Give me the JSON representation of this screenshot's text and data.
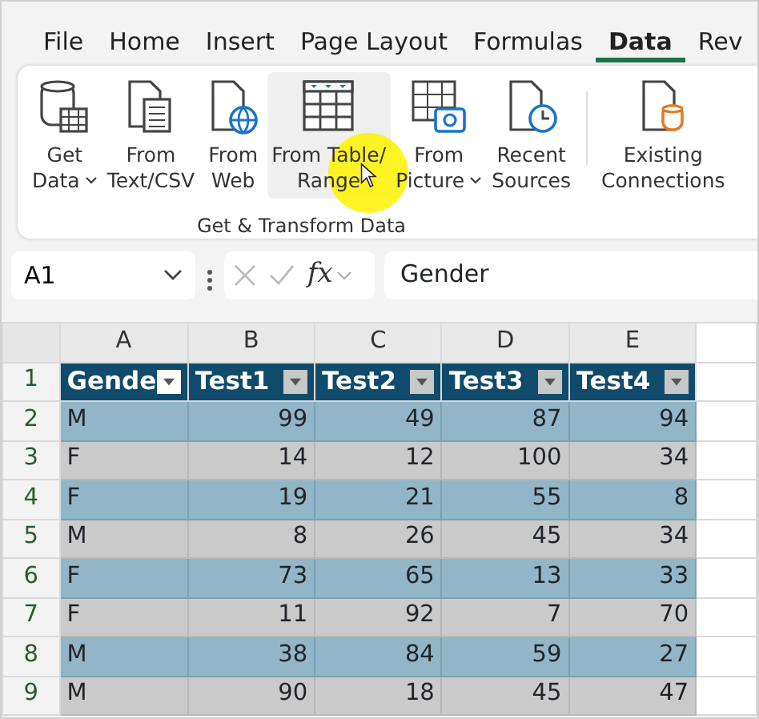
{
  "menu_tabs": [
    {
      "label": "File",
      "selected": false
    },
    {
      "label": "Home",
      "selected": false
    },
    {
      "label": "Insert",
      "selected": false
    },
    {
      "label": "Page Layout",
      "selected": false
    },
    {
      "label": "Formulas",
      "selected": false
    },
    {
      "label": "Data",
      "selected": true
    },
    {
      "label": "Rev",
      "selected": false
    }
  ],
  "ribbon": {
    "buttons": [
      {
        "lines": [
          "Get",
          "Data"
        ],
        "dropdown": true,
        "hovered": false
      },
      {
        "lines": [
          "From",
          "Text/CSV"
        ],
        "dropdown": false,
        "hovered": false
      },
      {
        "lines": [
          "From",
          "Web"
        ],
        "dropdown": false,
        "hovered": false
      },
      {
        "lines": [
          "From Table/",
          "Range"
        ],
        "dropdown": false,
        "hovered": true
      },
      {
        "lines": [
          "From",
          "Picture"
        ],
        "dropdown": true,
        "hovered": false
      },
      {
        "lines": [
          "Recent",
          "Sources"
        ],
        "dropdown": false,
        "hovered": false
      }
    ],
    "group_label": "Get & Transform Data",
    "extra_buttons": [
      {
        "lines": [
          "Existing",
          "Connections"
        ],
        "dropdown": false,
        "hovered": false
      }
    ]
  },
  "formula_bar": {
    "name_box": "A1",
    "function_label": "fx",
    "formula": "Gender"
  },
  "sheet": {
    "columns": [
      "A",
      "B",
      "C",
      "D",
      "E"
    ],
    "header_row": {
      "number": "1",
      "cells": [
        {
          "label": "Gende",
          "selected": true
        },
        {
          "label": "Test1",
          "selected": false
        },
        {
          "label": "Test2",
          "selected": false
        },
        {
          "label": "Test3",
          "selected": false
        },
        {
          "label": "Test4",
          "selected": false
        }
      ]
    },
    "rows": [
      {
        "number": "2",
        "cells": [
          "M",
          "99",
          "49",
          "87",
          "94"
        ]
      },
      {
        "number": "3",
        "cells": [
          "F",
          "14",
          "12",
          "100",
          "34"
        ]
      },
      {
        "number": "4",
        "cells": [
          "F",
          "19",
          "21",
          "55",
          "8"
        ]
      },
      {
        "number": "5",
        "cells": [
          "M",
          "8",
          "26",
          "45",
          "34"
        ]
      },
      {
        "number": "6",
        "cells": [
          "F",
          "73",
          "65",
          "13",
          "33"
        ]
      },
      {
        "number": "7",
        "cells": [
          "F",
          "11",
          "92",
          "7",
          "70"
        ]
      },
      {
        "number": "8",
        "cells": [
          "M",
          "38",
          "84",
          "59",
          "27"
        ]
      },
      {
        "number": "9",
        "cells": [
          "M",
          "90",
          "18",
          "45",
          "47"
        ]
      }
    ]
  }
}
